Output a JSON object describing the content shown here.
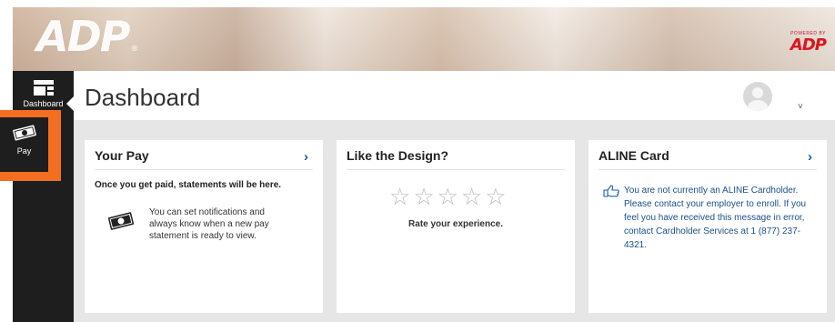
{
  "brand": {
    "logo_text": "ADP",
    "logo_reg": "®",
    "powered_by": "POWERED BY",
    "powered_mark": "ADP",
    "colors": {
      "accent": "#f26f21",
      "nav_bg": "#1e1e1e",
      "link": "#1a5fa8",
      "brand_red": "#d71920"
    }
  },
  "sidebar": {
    "items": [
      {
        "label": "Dashboard",
        "icon": "dashboard-icon"
      },
      {
        "label": "Pay",
        "icon": "money-icon"
      }
    ]
  },
  "header": {
    "title": "Dashboard",
    "avatar_icon": "user-avatar-icon",
    "menu_caret": "˅"
  },
  "cards": {
    "your_pay": {
      "title": "Your Pay",
      "chevron": "›",
      "message": "Once you get paid, statements will be here.",
      "note": "You can set notifications and always know when a new pay statement is ready to view."
    },
    "design": {
      "title": "Like the Design?",
      "rating": 0,
      "max_rating": 5,
      "prompt": "Rate your experience."
    },
    "aline": {
      "title": "ALINE Card",
      "chevron": "›",
      "message": "You are not currently an ALINE Cardholder. Please contact your employer to enroll. If you feel you have received this message in error, contact Cardholder Services at 1 (877) 237-4321."
    }
  }
}
